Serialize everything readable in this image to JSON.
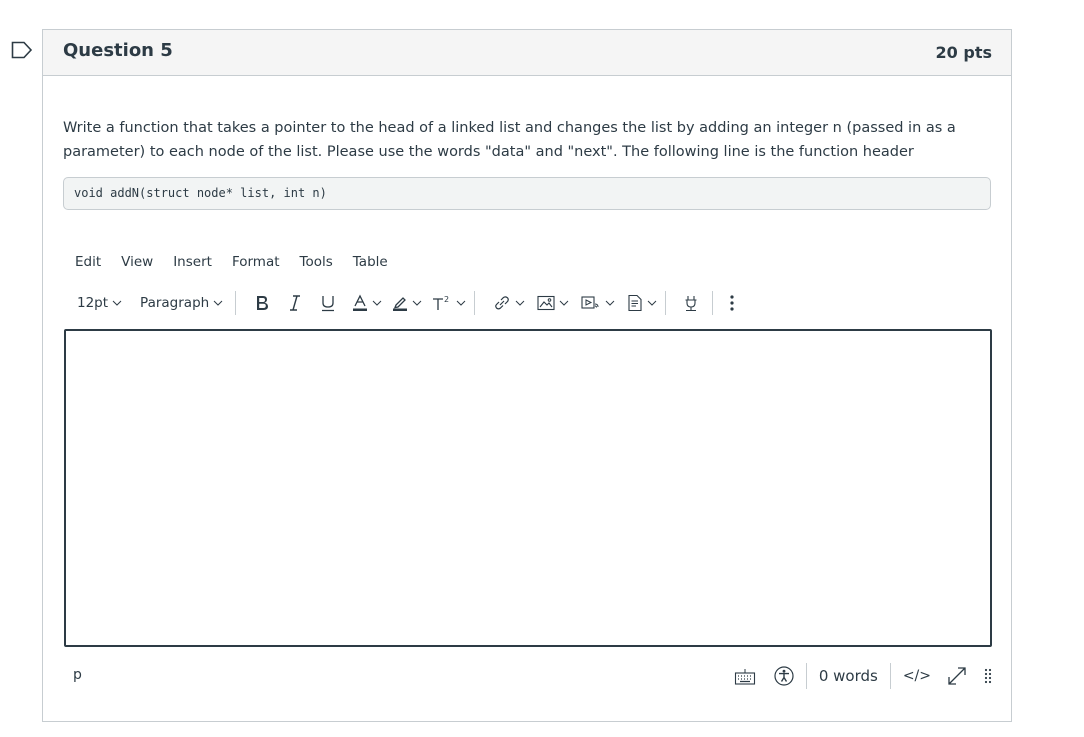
{
  "question": {
    "title": "Question 5",
    "points": "20 pts",
    "text": "Write a function that takes a pointer to the head of a linked list and changes the list by adding an integer n (passed in as a parameter) to each node of the list.  Please use the words \"data\" and \"next\". The following line is the function header",
    "code": "void addN(struct node* list, int n)"
  },
  "editor": {
    "menu": [
      "Edit",
      "View",
      "Insert",
      "Format",
      "Tools",
      "Table"
    ],
    "font_size": "12pt",
    "block_format": "Paragraph",
    "path": "p",
    "word_count": "0 words",
    "html_toggle": "</>",
    "content": ""
  },
  "icons": {
    "flag": "flag-outline-icon",
    "bold": "bold-icon",
    "italic": "italic-icon",
    "underline": "underline-icon",
    "text_color": "text-color-icon",
    "highlight": "highlight-icon",
    "superscript": "superscript-icon",
    "link": "link-icon",
    "image": "image-icon",
    "media": "media-icon",
    "document": "document-icon",
    "apps": "plug-icon",
    "more": "more-vertical-icon",
    "keyboard": "keyboard-icon",
    "accessibility": "accessibility-icon",
    "fullscreen": "expand-icon",
    "resize": "resize-handle-icon"
  },
  "colors": {
    "text": "#2d3b45",
    "border": "#c7cdd1",
    "header_bg": "#f5f5f5",
    "code_bg": "#f2f4f4"
  }
}
